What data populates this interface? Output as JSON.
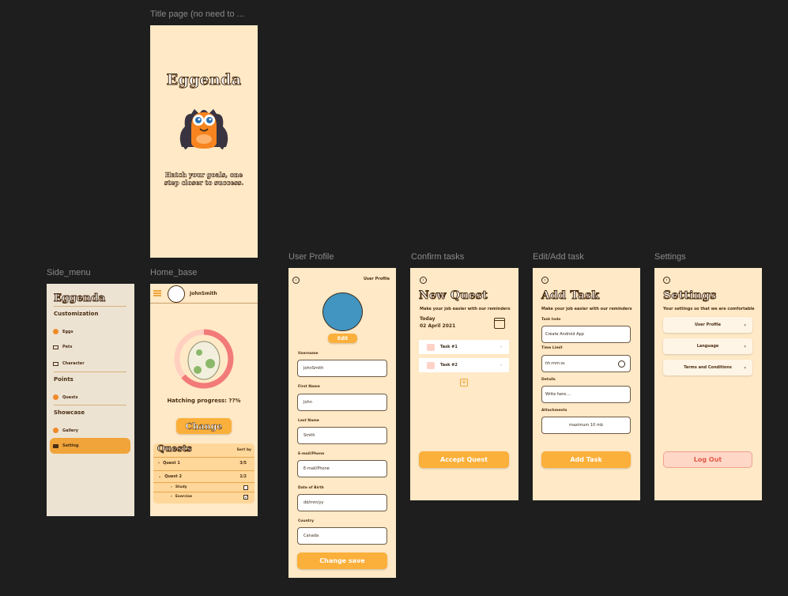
{
  "frames": {
    "title_page": "Title page (no need to ...",
    "side_menu": "Side_menu",
    "home_base": "Home_base",
    "user_profile": "User Profile",
    "confirm_tasks": "Confirm tasks",
    "edit_add_task": "Edit/Add task",
    "settings": "Settings"
  },
  "title_page": {
    "app_name": "Eggenda",
    "tagline": "Hatch your goals, one step closer to success."
  },
  "side_menu": {
    "app_name": "Eggenda",
    "sections": [
      {
        "title": "Customization",
        "items": [
          "Eggs",
          "Pets",
          "Character"
        ]
      },
      {
        "title": "Points",
        "items": [
          "Quests"
        ]
      },
      {
        "title": "Showcase",
        "items": [
          "Gallery",
          "Setting"
        ]
      }
    ]
  },
  "home_base": {
    "username": "JohnSmith",
    "progress_text": "Hatching progress: ??%",
    "change_label": "Change",
    "quests_title": "Quests",
    "sort_label": "Sort by",
    "quests": [
      {
        "name": "Quest 1",
        "count": "3/5"
      },
      {
        "name": "Quest 2",
        "count": "1/2"
      }
    ],
    "subtasks": [
      {
        "name": "Study",
        "checked": false
      },
      {
        "name": "Exercise",
        "checked": true
      }
    ]
  },
  "user_profile": {
    "header": "User Profile",
    "edit_label": "Edit",
    "avatar_color": "#4195c0",
    "fields": [
      {
        "label": "Username",
        "value": "JohnSmith"
      },
      {
        "label": "First Name",
        "value": "John"
      },
      {
        "label": "Last Name",
        "value": "Smith"
      },
      {
        "label": "E-mail/Phone",
        "value": "E-mail/Phone"
      },
      {
        "label": "Date of Birth",
        "value": "dd/mm/yy"
      },
      {
        "label": "Country",
        "value": "Canada"
      }
    ],
    "save_label": "Change save"
  },
  "confirm_tasks": {
    "title": "New Quest",
    "subtitle": "Make your job easier with our reminders",
    "today_label": "Today",
    "date": "02 April 2021",
    "tasks": [
      "Task #1",
      "Task #2"
    ],
    "accept_label": "Accept Quest"
  },
  "add_task": {
    "title": "Add Task",
    "subtitle": "Make your job easier with our reminders",
    "task_todo_label": "Task todo",
    "task_todo_value": "Create Android App",
    "time_limit_label": "Time Limit",
    "time_limit_value": "hh:mm:ss",
    "details_label": "Details",
    "details_value": "Write here....",
    "attachments_label": "Attachments",
    "attachments_value": "maximum 10 mb",
    "add_label": "Add Task"
  },
  "settings": {
    "title": "Settings",
    "subtitle": "Your settings so that we are comfortable",
    "items": [
      "User Profile",
      "Language",
      "Terms and Conditions"
    ],
    "logout_label": "Log Out"
  },
  "colors": {
    "frame_bg": "#ffe9c6",
    "accent": "#fbb03b",
    "side_bg": "#ede3d3",
    "progress_ring": "#f27a78",
    "logout_text": "#e05a4a"
  }
}
